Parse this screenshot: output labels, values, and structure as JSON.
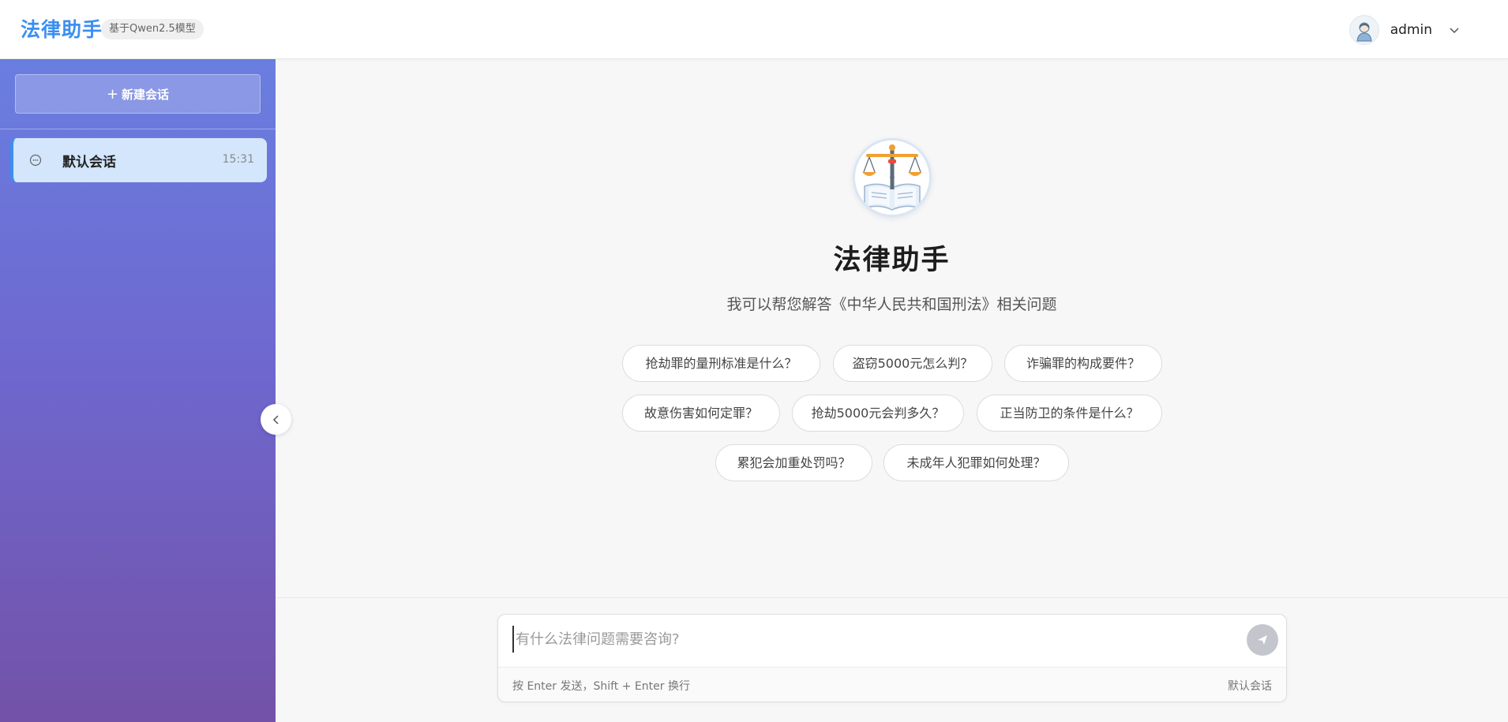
{
  "header": {
    "app_title": "法律助手",
    "model_badge": "基于Qwen2.5模型",
    "username": "admin"
  },
  "sidebar": {
    "new_chat_label": "新建会话",
    "sessions": [
      {
        "title": "默认会话",
        "time": "15:31"
      }
    ]
  },
  "main": {
    "welcome_title": "法律助手",
    "welcome_subtitle": "我可以帮您解答《中华人民共和国刑法》相关问题",
    "suggestions": [
      "抢劫罪的量刑标准是什么？",
      "盗窃5000元怎么判？",
      "诈骗罪的构成要件？",
      "故意伤害如何定罪？",
      "抢劫5000元会判多久？",
      "正当防卫的条件是什么？",
      "累犯会加重处罚吗？",
      "未成年人犯罪如何处理？"
    ]
  },
  "input": {
    "placeholder": "有什么法律问题需要咨询?",
    "value": "",
    "hint": "按 Enter 发送，Shift + Enter 换行",
    "current_session": "默认会话"
  },
  "icons": {
    "avatar": "user-avatar-icon",
    "user_menu": "chevron-down-icon",
    "new_chat": "plus-icon",
    "session": "chat-bubble-icon",
    "collapse": "chevron-left-icon",
    "logo": "scales-of-justice-icon",
    "send": "send-icon"
  },
  "colors": {
    "brand": "#3b8ff0",
    "sidebar_top": "#6a7ee0",
    "sidebar_bottom": "#7352a8",
    "active_session_bg": "#d3e6fb",
    "send_disabled": "#c3c6cc"
  }
}
